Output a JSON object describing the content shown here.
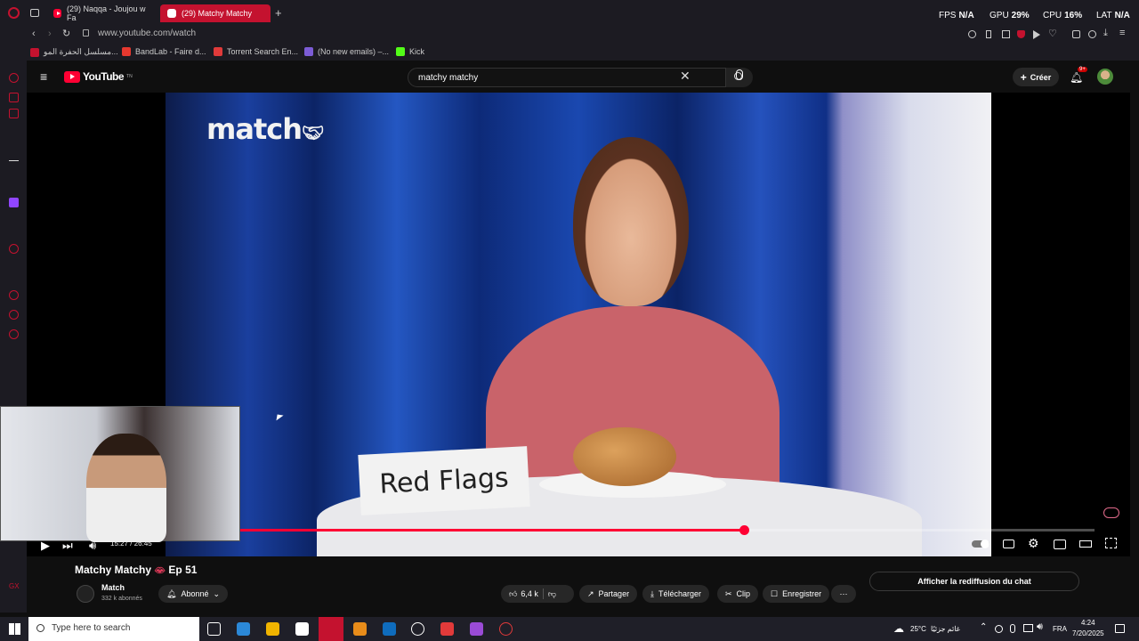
{
  "browser": {
    "tabs": [
      {
        "label": "(29) Naqqa - Joujou w Fa"
      },
      {
        "label": "(29) Matchy Matchy"
      }
    ],
    "url": "www.youtube.com/watch",
    "stats": {
      "fps_label": "FPS",
      "fps_value": "N/A",
      "gpu_label": "GPU",
      "gpu_value": "29%",
      "cpu_label": "CPU",
      "cpu_value": "16%",
      "lat_label": "LAT",
      "lat_value": "N/A"
    },
    "bookmarks": [
      {
        "label": "مسلسل الحفرة المو...",
        "color": "#c4122f"
      },
      {
        "label": "BandLab - Faire d...",
        "color": "#e6382f"
      },
      {
        "label": "Torrent Search En...",
        "color": "#e03a3a"
      },
      {
        "label": "(No new emails) –...",
        "color": "#7c5cd6"
      },
      {
        "label": "Kick",
        "color": "#53fc18"
      }
    ]
  },
  "youtube": {
    "logo": "YouTube",
    "logo_sup": "TN",
    "search_value": "matchy matchy",
    "create_label": "Créer",
    "notif_count": "9+",
    "video": {
      "brand_text": "match",
      "sign_text": "Red Flags",
      "time_current": "15:27",
      "time_total": "26:45",
      "time_sep": " / ",
      "progress": 0.59
    },
    "title": "Matchy Matchy",
    "title_suffix": "Ep 51",
    "channel": {
      "name": "Match",
      "subs": "332 k abonnés",
      "subscribe_label": "Abonné"
    },
    "actions": {
      "likes": "6,4 k",
      "share": "Partager",
      "download": "Télécharger",
      "clip": "Clip",
      "save": "Enregistrer"
    },
    "chat_replay": "Afficher la rediffusion du chat"
  },
  "taskbar": {
    "search_placeholder": "Type here to search",
    "weather": "25°C",
    "weather_desc": "غائم جزئيًا",
    "lang": "FRA",
    "time": "4:24",
    "date": "7/20/2025",
    "icon_colors": [
      "#2b88d8",
      "#f0b400",
      "#e88c1a",
      "#0f6cbd",
      "#e23a3a",
      "#9a4bd6",
      "#3a3a3a"
    ]
  }
}
